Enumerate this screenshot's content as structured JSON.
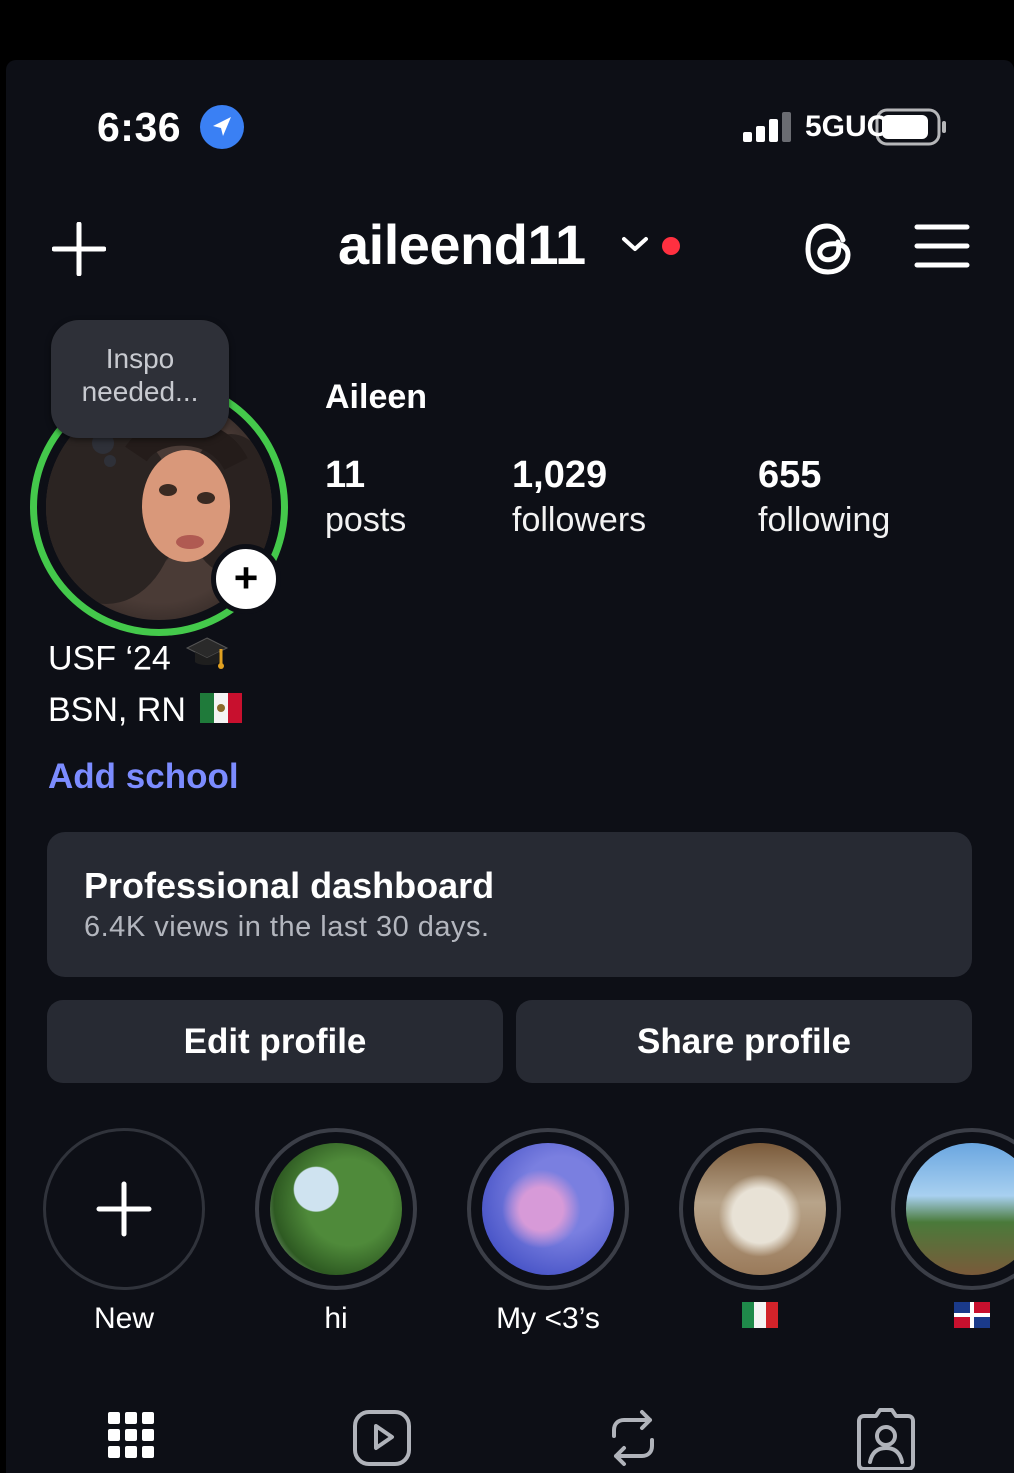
{
  "status_bar": {
    "time": "6:36",
    "network": "5GUC",
    "icons": [
      "location-arrow-icon",
      "cellular-signal-icon",
      "battery-icon"
    ]
  },
  "header": {
    "username": "aileend11",
    "icons": [
      "plus-icon",
      "chevron-down-icon",
      "threads-icon",
      "hamburger-menu-icon"
    ],
    "notification_color": "#ff3040"
  },
  "profile": {
    "note_text": "Inspo needed...",
    "story_ring_color": "#44c94b",
    "name": "Aileen",
    "stats": [
      {
        "value": "11",
        "label": "posts"
      },
      {
        "value": "1,029",
        "label": "followers"
      },
      {
        "value": "655",
        "label": "following"
      }
    ],
    "bio_lines": [
      "USF ‘24",
      "BSN, RN"
    ],
    "bio_icons": [
      "graduation-cap-icon",
      "mexico-flag-icon"
    ],
    "add_school": "Add school",
    "link_color": "#7c8cff"
  },
  "dashboard": {
    "title": "Professional dashboard",
    "subtitle": "6.4K views in the last 30 days."
  },
  "buttons": {
    "edit": "Edit profile",
    "share": "Share profile"
  },
  "highlights": [
    {
      "label": "New"
    },
    {
      "label": "hi"
    },
    {
      "label": "My <3’s"
    },
    {
      "label": "",
      "icon": "italy-flag-icon"
    },
    {
      "label": "",
      "icon": "dominican-republic-flag-icon"
    }
  ],
  "tabs": [
    "grid-icon",
    "reels-icon",
    "reposts-icon",
    "tagged-icon"
  ]
}
